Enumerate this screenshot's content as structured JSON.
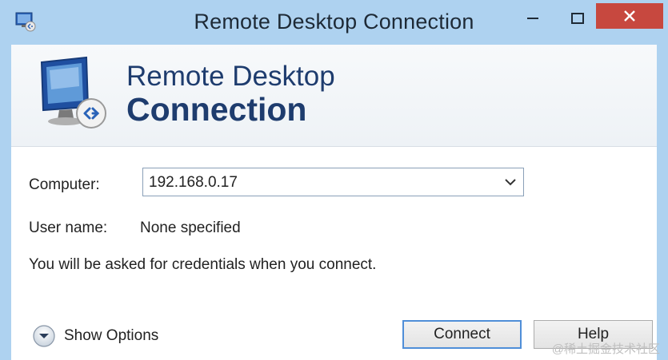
{
  "window": {
    "title": "Remote Desktop Connection"
  },
  "banner": {
    "line1": "Remote Desktop",
    "line2": "Connection"
  },
  "form": {
    "computer_label": "Computer:",
    "computer_value": "192.168.0.17",
    "username_label": "User name:",
    "username_value": "None specified",
    "info": "You will be asked for credentials when you connect."
  },
  "footer": {
    "show_options_label": "Show Options",
    "connect_label": "Connect",
    "help_label": "Help"
  },
  "watermark": "@稀土掘金技术社区",
  "colors": {
    "titlebar": "#aed2f0",
    "close_button": "#c7483f",
    "banner_text": "#1e3c6e",
    "default_button_border": "#4f8ed8"
  },
  "icons": {
    "system": "remote-desktop-icon",
    "minimize": "minimize-icon",
    "maximize": "maximize-icon",
    "close": "close-icon",
    "dropdown": "chevron-down-icon",
    "options": "expand-circle-icon"
  }
}
